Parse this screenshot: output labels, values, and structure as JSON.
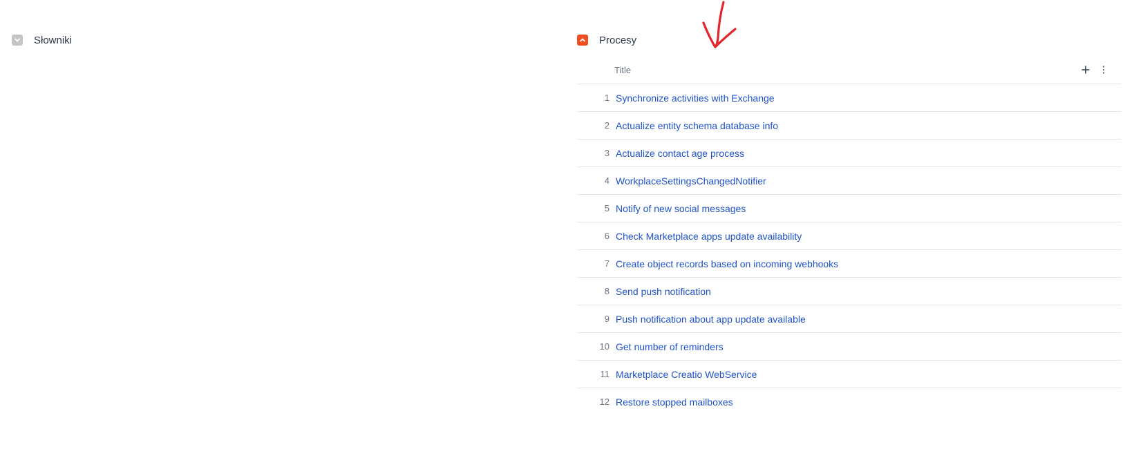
{
  "sections": {
    "left": {
      "title": "Słowniki",
      "state": "collapsed"
    },
    "right": {
      "title": "Procesy",
      "state": "expanded"
    }
  },
  "grid": {
    "columns": {
      "title_header": "Title"
    },
    "rows": [
      {
        "num": "1",
        "title": "Synchronize activities with Exchange"
      },
      {
        "num": "2",
        "title": "Actualize entity schema database info"
      },
      {
        "num": "3",
        "title": "Actualize contact age process"
      },
      {
        "num": "4",
        "title": "WorkplaceSettingsChangedNotifier"
      },
      {
        "num": "5",
        "title": "Notify of new social messages"
      },
      {
        "num": "6",
        "title": "Check Marketplace apps update availability"
      },
      {
        "num": "7",
        "title": "Create object records based on incoming webhooks"
      },
      {
        "num": "8",
        "title": "Send push notification"
      },
      {
        "num": "9",
        "title": "Push notification about app update available"
      },
      {
        "num": "10",
        "title": "Get number of reminders"
      },
      {
        "num": "11",
        "title": "Marketplace Creatio WebService"
      },
      {
        "num": "12",
        "title": "Restore stopped mailboxes"
      }
    ]
  },
  "colors": {
    "accent": "#f04e23",
    "collapsed_toggle": "#c4c4c4",
    "link": "#1f52c9",
    "annotation": "#e3242b"
  },
  "icons": {
    "left_toggle": "chevron-down-icon",
    "right_toggle": "chevron-up-icon",
    "add": "plus-icon",
    "more": "vertical-dots-icon",
    "annotation": "hand-drawn-arrow-icon"
  }
}
